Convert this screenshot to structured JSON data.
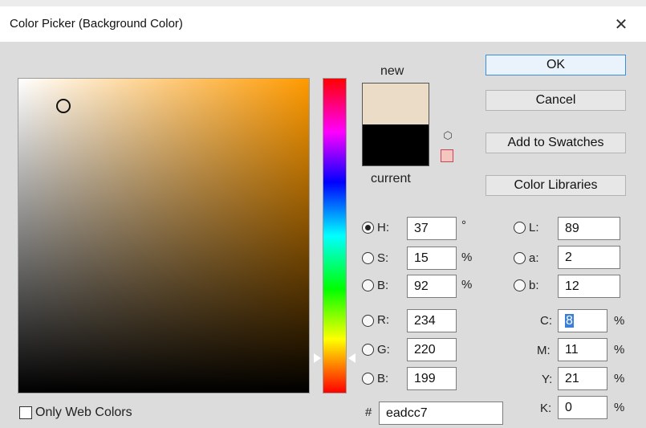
{
  "window": {
    "title": "Color Picker (Background Color)",
    "close_glyph": "✕"
  },
  "swatches": {
    "new_label": "new",
    "current_label": "current",
    "new_color": "#eadcc7",
    "current_color": "#000000"
  },
  "buttons": {
    "ok": "OK",
    "cancel": "Cancel",
    "add_to_swatches": "Add to Swatches",
    "color_libraries": "Color Libraries"
  },
  "hsb": {
    "h": {
      "label": "H:",
      "value": "37",
      "unit": "°",
      "selected": true
    },
    "s": {
      "label": "S:",
      "value": "15",
      "unit": "%"
    },
    "b": {
      "label": "B:",
      "value": "92",
      "unit": "%"
    }
  },
  "rgb": {
    "r": {
      "label": "R:",
      "value": "234"
    },
    "g": {
      "label": "G:",
      "value": "220"
    },
    "b": {
      "label": "B:",
      "value": "199"
    }
  },
  "lab": {
    "l": {
      "label": "L:",
      "value": "89"
    },
    "a": {
      "label": "a:",
      "value": "2"
    },
    "b": {
      "label": "b:",
      "value": "12"
    }
  },
  "cmyk": {
    "c": {
      "label": "C:",
      "value": "8",
      "unit": "%"
    },
    "m": {
      "label": "M:",
      "value": "11",
      "unit": "%"
    },
    "y": {
      "label": "Y:",
      "value": "21",
      "unit": "%"
    },
    "k": {
      "label": "K:",
      "value": "0",
      "unit": "%"
    }
  },
  "hex": {
    "label": "#",
    "value": "eadcc7"
  },
  "only_web_colors": {
    "label": "Only Web Colors",
    "checked": false
  },
  "icons": {
    "gamut_cube": "cube-icon",
    "web_safe_swatch": "websafe-swatch-icon"
  },
  "accent_color": "#3c8fd8"
}
